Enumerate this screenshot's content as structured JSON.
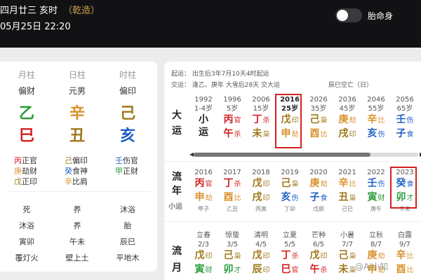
{
  "header": {
    "lunar": "四月廿三 亥时",
    "qianzao": "（乾造）",
    "solar": "05月25日 22:20",
    "toggle_label": "胎命身"
  },
  "colors": {
    "wood": "#2a9b3a",
    "fire": "#d22020",
    "earth": "#a0781a",
    "metal": "#d9922a",
    "water": "#2060c8",
    "highlight": "#d42020"
  },
  "pillars": [
    {
      "header": "月柱",
      "shishen": "偏财",
      "gan": "乙",
      "gan_color": "#2a9b3a",
      "zhi": "巳",
      "zhi_color": "#d22020",
      "canggan": [
        {
          "g": "丙",
          "gc": "#d22020",
          "s": "正官"
        },
        {
          "g": "庚",
          "gc": "#d9922a",
          "s": "劫财"
        },
        {
          "g": "戊",
          "gc": "#a0781a",
          "s": "正印"
        }
      ],
      "states": [
        "死",
        "沐浴",
        "寅卯",
        "覆灯火"
      ]
    },
    {
      "header": "日柱",
      "shishen": "元男",
      "gan": "辛",
      "gan_color": "#d9922a",
      "zhi": "丑",
      "zhi_color": "#a0781a",
      "canggan": [
        {
          "g": "己",
          "gc": "#a0781a",
          "s": "偏印"
        },
        {
          "g": "癸",
          "gc": "#2060c8",
          "s": "食神"
        },
        {
          "g": "辛",
          "gc": "#d9922a",
          "s": "比肩"
        }
      ],
      "states": [
        "养",
        "养",
        "午未",
        "壁上土"
      ]
    },
    {
      "header": "时柱",
      "shishen": "偏印",
      "gan": "己",
      "gan_color": "#a0781a",
      "zhi": "亥",
      "zhi_color": "#2060c8",
      "canggan": [
        {
          "g": "壬",
          "gc": "#2060c8",
          "s": "伤官"
        },
        {
          "g": "甲",
          "gc": "#2a9b3a",
          "s": "正财"
        }
      ],
      "states": [
        "沐浴",
        "胎",
        "辰巳",
        "平地木"
      ]
    }
  ],
  "notes": {
    "qiyun": "起运：   出生后3年7月10天4时起运",
    "jiaoyun": "交运：   逢乙、庚年 大雪后28天 交大运",
    "kong": "辰巳空亡（日）"
  },
  "dayun": {
    "label": "大运",
    "items": [
      {
        "year": "1992",
        "age": "1-4岁",
        "gan": "小",
        "zhi": "运",
        "gs": "",
        "zs": ""
      },
      {
        "year": "1996",
        "age": "5岁",
        "gan": "丙",
        "zhi": "午",
        "gs": "官",
        "zs": "杀",
        "gc": "#d22020",
        "zc": "#d22020"
      },
      {
        "year": "2006",
        "age": "15岁",
        "gan": "丁",
        "zhi": "未",
        "gs": "杀",
        "zs": "枭",
        "gc": "#d22020",
        "zc": "#a0781a"
      },
      {
        "year": "2016",
        "age": "25岁",
        "gan": "戊",
        "zhi": "申",
        "gs": "印",
        "zs": "劫",
        "gc": "#a0781a",
        "zc": "#d9922a"
      },
      {
        "year": "2026",
        "age": "35岁",
        "gan": "己",
        "zhi": "酉",
        "gs": "枭",
        "zs": "比",
        "gc": "#a0781a",
        "zc": "#d9922a"
      },
      {
        "year": "2036",
        "age": "45岁",
        "gan": "庚",
        "zhi": "戌",
        "gs": "劫",
        "zs": "印",
        "gc": "#d9922a",
        "zc": "#a0781a"
      },
      {
        "year": "2046",
        "age": "55岁",
        "gan": "辛",
        "zhi": "亥",
        "gs": "比",
        "zs": "伤",
        "gc": "#d9922a",
        "zc": "#2060c8"
      },
      {
        "year": "2056",
        "age": "65岁",
        "gan": "壬",
        "zhi": "子",
        "gs": "伤",
        "zs": "食",
        "gc": "#2060c8",
        "zc": "#2060c8"
      }
    ]
  },
  "liunian": {
    "label1": "流",
    "label2": "年",
    "label3": "小运",
    "items": [
      {
        "year": "2016",
        "gan": "丙",
        "zhi": "申",
        "gs": "官",
        "zs": "劫",
        "gc": "#d22020",
        "zc": "#d9922a",
        "xy": "甲子"
      },
      {
        "year": "2017",
        "gan": "丁",
        "zhi": "酉",
        "gs": "杀",
        "zs": "比",
        "gc": "#d22020",
        "zc": "#d9922a",
        "xy": "乙丑"
      },
      {
        "year": "2018",
        "gan": "戊",
        "zhi": "戌",
        "gs": "印",
        "zs": "印",
        "gc": "#a0781a",
        "zc": "#a0781a",
        "xy": "丙寅"
      },
      {
        "year": "2019",
        "gan": "己",
        "zhi": "亥",
        "gs": "枭",
        "zs": "伤",
        "gc": "#a0781a",
        "zc": "#2060c8",
        "xy": "丁卯"
      },
      {
        "year": "2020",
        "gan": "庚",
        "zhi": "子",
        "gs": "劫",
        "zs": "食",
        "gc": "#d9922a",
        "zc": "#2060c8",
        "xy": "戊辰"
      },
      {
        "year": "2021",
        "gan": "辛",
        "zhi": "丑",
        "gs": "比",
        "zs": "枭",
        "gc": "#d9922a",
        "zc": "#a0781a",
        "xy": "己巳"
      },
      {
        "year": "2022",
        "gan": "壬",
        "zhi": "寅",
        "gs": "伤",
        "zs": "财",
        "gc": "#2060c8",
        "zc": "#2a9b3a",
        "xy": "庚午"
      },
      {
        "year": "2023",
        "gan": "癸",
        "zhi": "卯",
        "gs": "食",
        "zs": "才",
        "gc": "#2060c8",
        "zc": "#2a9b3a",
        "xy": "辛未"
      }
    ]
  },
  "liuyue": {
    "label1": "流",
    "label2": "月",
    "items": [
      {
        "term": "立春",
        "date": "2/3",
        "gan": "戊",
        "zhi": "寅",
        "gs": "印",
        "zs": "财",
        "gc": "#a0781a",
        "zc": "#2a9b3a"
      },
      {
        "term": "惊蛰",
        "date": "3/5",
        "gan": "己",
        "zhi": "卯",
        "gs": "枭",
        "zs": "才",
        "gc": "#a0781a",
        "zc": "#2a9b3a"
      },
      {
        "term": "清明",
        "date": "4/5",
        "gan": "戊",
        "zhi": "辰",
        "gs": "印",
        "zs": "印",
        "gc": "#a0781a",
        "zc": "#a0781a"
      },
      {
        "term": "立夏",
        "date": "5/5",
        "gan": "丁",
        "zhi": "巳",
        "gs": "杀",
        "zs": "官",
        "gc": "#d22020",
        "zc": "#d22020"
      },
      {
        "term": "芒种",
        "date": "6/5",
        "gan": "戊",
        "zhi": "午",
        "gs": "印",
        "zs": "杀",
        "gc": "#a0781a",
        "zc": "#d22020"
      },
      {
        "term": "小暑",
        "date": "7/7",
        "gan": "己",
        "zhi": "未",
        "gs": "枭",
        "zs": "枭",
        "gc": "#a0781a",
        "zc": "#a0781a"
      },
      {
        "term": "立秋",
        "date": "8/7",
        "gan": "庚",
        "zhi": "申",
        "gs": "劫",
        "zs": "劫",
        "gc": "#d9922a",
        "zc": "#d9922a"
      },
      {
        "term": "白露",
        "date": "9/7",
        "gan": "辛",
        "zhi": "酉",
        "gs": "比",
        "zs": "比",
        "gc": "#d9922a",
        "zc": "#d9922a"
      }
    ]
  },
  "watermark": "@Ai小知"
}
